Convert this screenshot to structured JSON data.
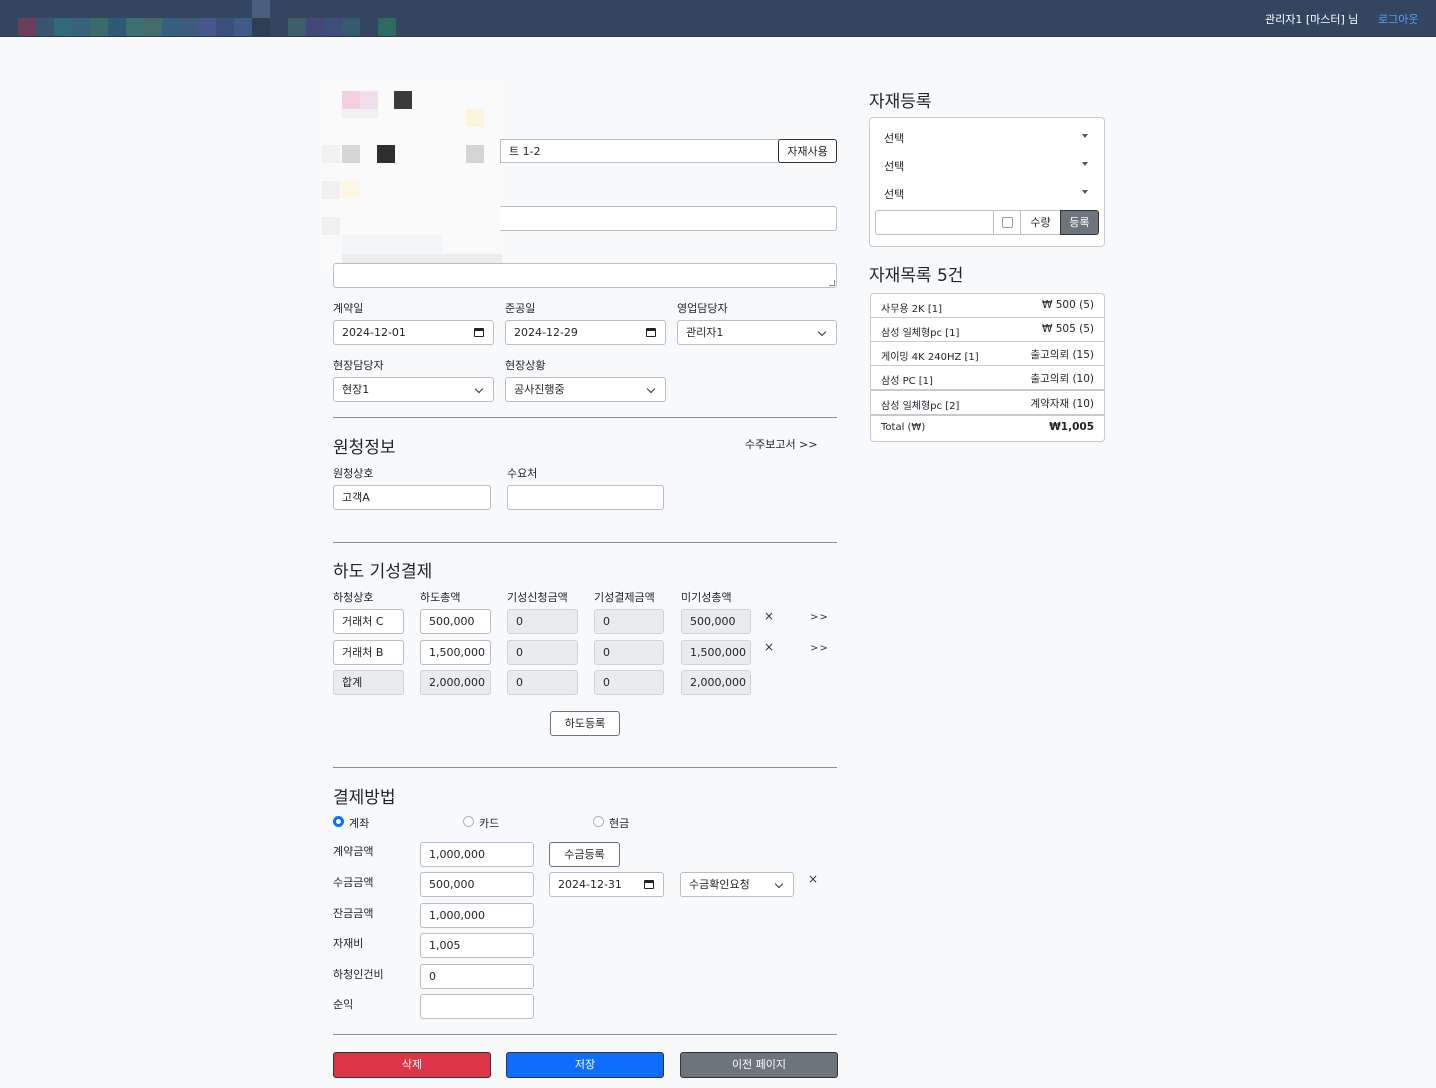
{
  "topbar": {
    "user": "관리자1 [마스터] 님",
    "logout": "로그아웃"
  },
  "header": {
    "material_use_button": "자재사용",
    "address_partial": "트 1-2"
  },
  "contract": {
    "contract_date_label": "계약일",
    "contract_date": "2024-12-01",
    "completion_date_label": "준공일",
    "completion_date": "2024-12-29",
    "sales_manager_label": "영업담당자",
    "sales_manager": "관리자1",
    "site_manager_label": "현장담당자",
    "site_manager": "현장1",
    "site_status_label": "현장상황",
    "site_status": "공사진행중"
  },
  "client": {
    "title": "원청정보",
    "report_link": "수주보고서 >>",
    "company_label": "원청상호",
    "company": "고객A",
    "orderer_label": "수요처",
    "orderer": ""
  },
  "subcontract": {
    "title": "하도 기성결제",
    "headers": [
      "하청상호",
      "하도총액",
      "기성신청금액",
      "기성결제금액",
      "미기성총액"
    ],
    "rows": [
      {
        "name": "거래처 C",
        "total": "500,000",
        "requested": "0",
        "paid": "0",
        "remaining": "500,000"
      },
      {
        "name": "거래처 B",
        "total": "1,500,000",
        "requested": "0",
        "paid": "0",
        "remaining": "1,500,000"
      }
    ],
    "sum": {
      "name": "합계",
      "total": "2,000,000",
      "requested": "0",
      "paid": "0",
      "remaining": "2,000,000"
    },
    "remove": "×",
    "detail": ">>",
    "register_button": "하도등록"
  },
  "payment": {
    "title": "결제방법",
    "methods": [
      "계좌",
      "카드",
      "현금"
    ],
    "selected": "계좌",
    "contract_amount_label": "계약금액",
    "contract_amount": "1,000,000",
    "receipt_register_button": "수금등록",
    "received_label": "수금금액",
    "received": "500,000",
    "received_date": "2024-12-31",
    "received_status": "수금확인요청",
    "remove": "×",
    "balance_label": "잔금금액",
    "balance": "1,000,000",
    "material_cost_label": "자재비",
    "material_cost": "1,005",
    "labor_label": "하청인건비",
    "labor": "0",
    "profit_label": "순익",
    "profit": ""
  },
  "actions": {
    "delete": "삭제",
    "save": "저장",
    "back": "이전 페이지"
  },
  "material_register": {
    "title": "자재등록",
    "selects": [
      "선택",
      "선택",
      "선택"
    ],
    "qty_label": "수량",
    "register": "등록"
  },
  "material_list": {
    "title": "자재목록 5건",
    "items": [
      {
        "name": "사무용 2K [1]",
        "value": "₩ 500 (5)"
      },
      {
        "name": "삼성 일체형pc [1]",
        "value": "₩ 505 (5)"
      },
      {
        "name": "게이밍 4K 240HZ [1]",
        "value": "출고의뢰 (15)"
      },
      {
        "name": "삼성 PC [1]",
        "value": "출고의뢰 (10)"
      },
      {
        "name": "삼성 일체형pc [2]",
        "value": "계약자재 (10)"
      }
    ],
    "total_label": "Total (₩)",
    "total_value": "₩1,005"
  },
  "colors": {
    "topbar": "#344560",
    "danger": "#dc3545",
    "primary": "#0d6efd",
    "secondary": "#6c757d"
  }
}
